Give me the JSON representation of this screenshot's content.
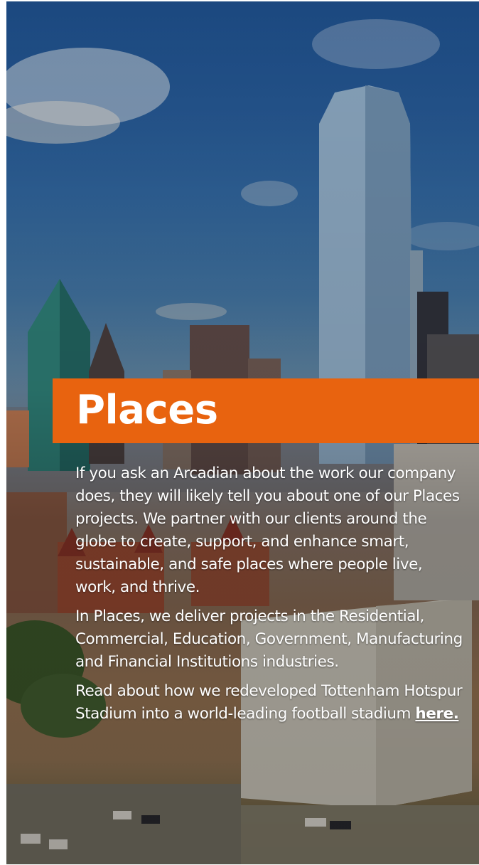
{
  "section": {
    "title": "Places",
    "accent_color": "#e8630f",
    "background_image": "dallas-skyline-photo"
  },
  "paragraphs": {
    "p1": "If you ask an Arcadian about the work our company does, they will likely tell you about one of our Places projects. We partner with our clients around the globe to create, support, and enhance smart, sustainable, and safe places where people live, work, and thrive.",
    "p2": "In Places, we deliver projects in the Residential, Commercial, Education, Government, Manufacturing and Financial Institutions industries.",
    "p3_text": "Read about how we redeveloped Tottenham Hotspur Stadium into a world-leading football stadium ",
    "p3_link": "here."
  }
}
